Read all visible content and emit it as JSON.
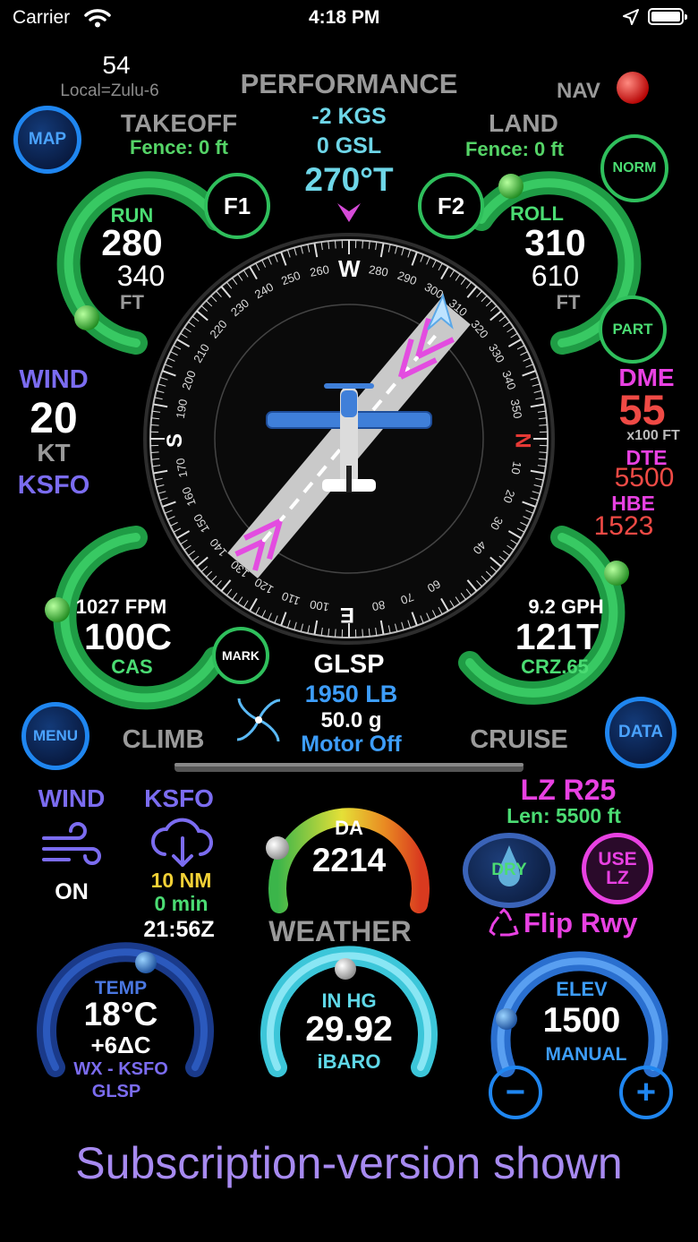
{
  "status_bar": {
    "carrier": "Carrier",
    "time": "4:18 PM"
  },
  "header": {
    "zulu_minutes": "54",
    "zulu_offset": "Local=Zulu-6",
    "title": "PERFORMANCE",
    "nav_label": "NAV"
  },
  "buttons": {
    "map": "MAP",
    "norm": "NORM",
    "part": "PART",
    "f1": "F1",
    "f2": "F2",
    "mark": "MARK",
    "menu": "MENU",
    "data": "DATA",
    "dry": "DRY",
    "use_lz_line1": "USE",
    "use_lz_line2": "LZ",
    "minus": "−",
    "plus": "+"
  },
  "performance": {
    "kgs": "-2 KGS",
    "gsl": "0 GSL",
    "heading": "270°T",
    "takeoff": {
      "label": "TAKEOFF",
      "fence": "Fence: 0 ft",
      "run_label": "RUN",
      "run": "280",
      "total": "340",
      "unit": "FT"
    },
    "land": {
      "label": "LAND",
      "fence": "Fence: 0 ft",
      "roll_label": "ROLL",
      "roll": "310",
      "total": "610",
      "unit": "FT"
    },
    "wind": {
      "label": "WIND",
      "value": "20",
      "unit": "KT",
      "station": "KSFO"
    },
    "dme": {
      "label": "DME",
      "value": "55",
      "unit": "x100 FT",
      "dte_label": "DTE",
      "dte": "5500",
      "hbe_label": "HBE",
      "hbe": "1523"
    },
    "climb": {
      "fpm": "1027 FPM",
      "speed": "100C",
      "speed_label": "CAS",
      "label": "CLIMB"
    },
    "cruise": {
      "gph": "9.2 GPH",
      "speed": "121T",
      "setting": "CRZ.65",
      "label": "CRUISE"
    },
    "aircraft": {
      "id": "GLSP",
      "weight": "1950 LB",
      "fuel": "50.0 g",
      "motor": "Motor Off"
    }
  },
  "compass": {
    "cardinals": {
      "north": "N",
      "south": "S",
      "east": "E",
      "west": "W"
    },
    "tick_labels": [
      "10",
      "20",
      "30",
      "40",
      "60",
      "70",
      "80",
      "100",
      "110",
      "120",
      "130",
      "140",
      "150",
      "160",
      "170",
      "190",
      "200",
      "210",
      "220",
      "230",
      "240",
      "250",
      "260",
      "280",
      "290",
      "300",
      "310",
      "320",
      "330",
      "340",
      "350"
    ]
  },
  "weather": {
    "title": "WEATHER",
    "wind_label": "WIND",
    "wind_state": "ON",
    "station": "KSFO",
    "distance": "10 NM",
    "age": "0 min",
    "zulu_time": "21:56Z",
    "da_label": "DA",
    "da_value": "2214",
    "landing_zone": "LZ R25",
    "lz_length": "Len: 5500 ft",
    "flip": "Flip Rwy",
    "temp_label": "TEMP",
    "temp": "18°C",
    "temp_delta": "+6ΔC",
    "temp_source": "WX - KSFO",
    "temp_aircraft": "GLSP",
    "baro_label": "IN HG",
    "baro": "29.92",
    "baro_source": "iBARO",
    "elev_label": "ELEV",
    "elev": "1500",
    "elev_mode": "MANUAL"
  },
  "footer": {
    "caption": "Subscription-version shown"
  }
}
